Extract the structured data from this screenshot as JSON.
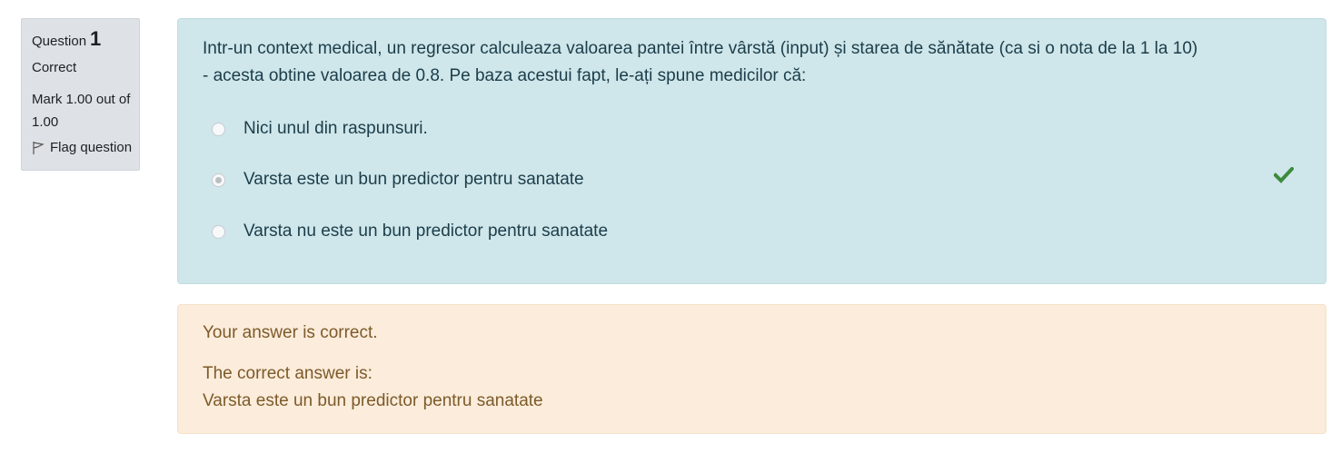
{
  "info": {
    "question_label": "Question",
    "question_number": "1",
    "state": "Correct",
    "grade_line1": "Mark 1.00 out of",
    "grade_line2": "1.00",
    "flag_label": "Flag question"
  },
  "question": {
    "text_line1": "Intr-un context medical, un regresor calculeaza valoarea pantei între vârstă (input) și starea de sănătate (ca si o nota de la 1 la 10)",
    "text_line2": "- acesta obtine valoarea de 0.8. Pe baza acestui fapt, le-ați spune medicilor că:",
    "options": [
      {
        "label": "Nici unul din raspunsuri.",
        "selected": false
      },
      {
        "label": "Varsta este un bun predictor pentru sanatate",
        "selected": true,
        "correct": true
      },
      {
        "label": "Varsta nu este un bun predictor pentru sanatate",
        "selected": false
      }
    ]
  },
  "feedback": {
    "result": "Your answer is correct.",
    "correct_label": "The correct answer is:",
    "correct_answer": "Varsta este un bun predictor pentru sanatate"
  },
  "icons": {
    "flag": "flag-outline-icon",
    "check": "checkmark-icon"
  },
  "colors": {
    "info_bg": "#dee2e6",
    "question_bg": "#cfe6ea",
    "feedback_bg": "#fbecdb",
    "check_green": "#3d8a3d"
  }
}
